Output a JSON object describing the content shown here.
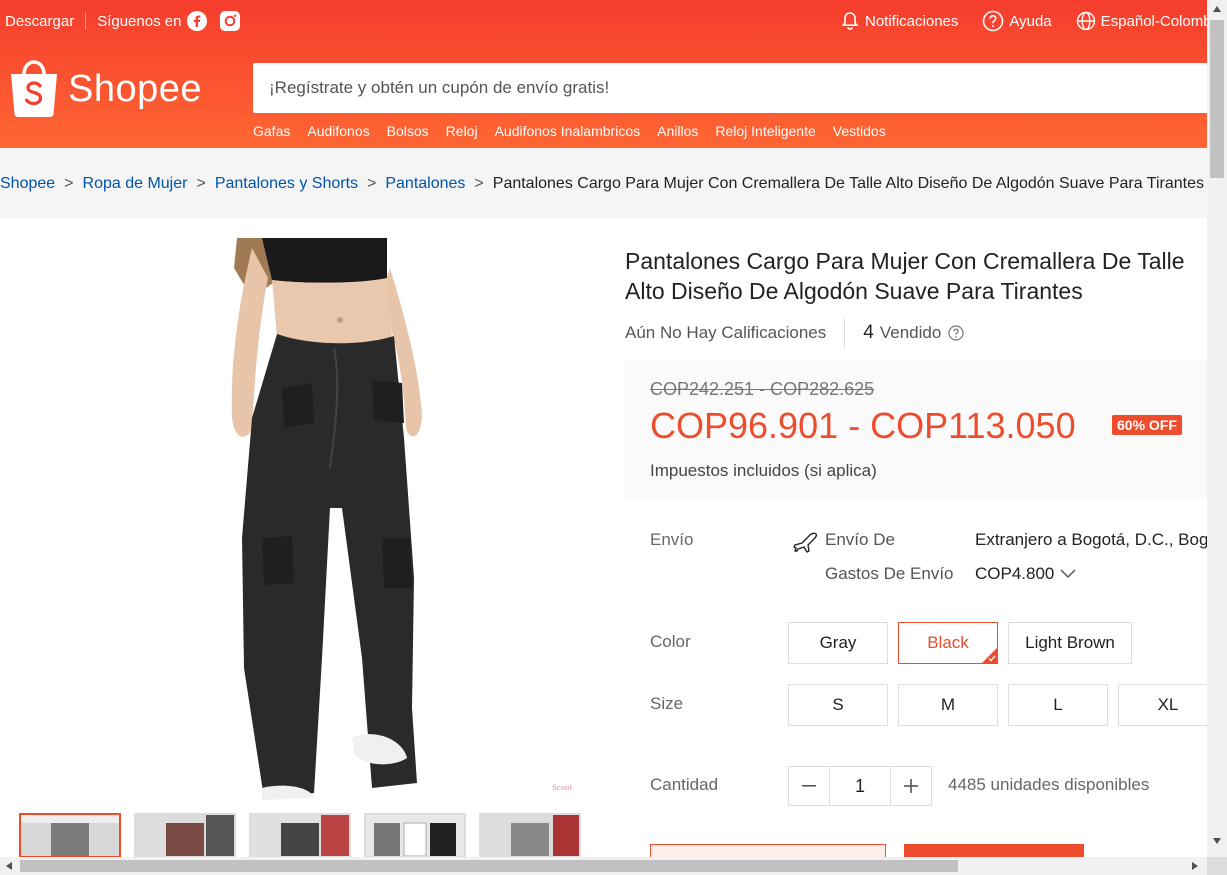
{
  "topbar": {
    "download": "Descargar",
    "follow": "Síguenos en",
    "notifications": "Notificaciones",
    "help": "Ayuda",
    "language": "Español-Colombia"
  },
  "logo": {
    "text": "Shopee"
  },
  "search": {
    "placeholder": "¡Regístrate y obtén un cupón de envío gratis!"
  },
  "keywords": [
    "Gafas",
    "Audifonos",
    "Bolsos",
    "Reloj",
    "Audifonos Inalambricos",
    "Anillos",
    "Reloj Inteligente",
    "Vestidos"
  ],
  "breadcrumb": {
    "items": [
      "Shopee",
      "Ropa de Mujer",
      "Pantalones y Shorts",
      "Pantalones"
    ],
    "current": "Pantalones Cargo Para Mujer Con Cremallera De Talle Alto Diseño De Algodón Suave Para Tirantes"
  },
  "product": {
    "title": "Pantalones Cargo Para Mujer Con Cremallera De Talle Alto Diseño De Algodón Suave Para Tirantes",
    "ratings": "Aún No Hay Calificaciones",
    "sold_count": "4",
    "sold_label": "Vendido",
    "original_price": "COP242.251 - COP282.625",
    "price": "COP96.901 - COP113.050",
    "discount": "60% OFF",
    "tax_note": "Impuestos incluidos (si aplica)",
    "image_watermark": "Scout"
  },
  "shipping": {
    "label": "Envío",
    "from_label": "Envío De",
    "from_value": "Extranjero a Bogotá, D.C., Bogotá",
    "cost_label": "Gastos De Envío",
    "cost_value": "COP4.800"
  },
  "color": {
    "label": "Color",
    "options": [
      "Gray",
      "Black",
      "Light Brown"
    ],
    "selected": "Black"
  },
  "size": {
    "label": "Size",
    "options": [
      "S",
      "M",
      "L",
      "XL"
    ]
  },
  "quantity": {
    "label": "Cantidad",
    "value": "1",
    "stock": "4485 unidades disponibles"
  },
  "colors": {
    "brand": "#ee4d2d",
    "header_top": "#f53d2d",
    "header_bottom": "#ff6633"
  }
}
